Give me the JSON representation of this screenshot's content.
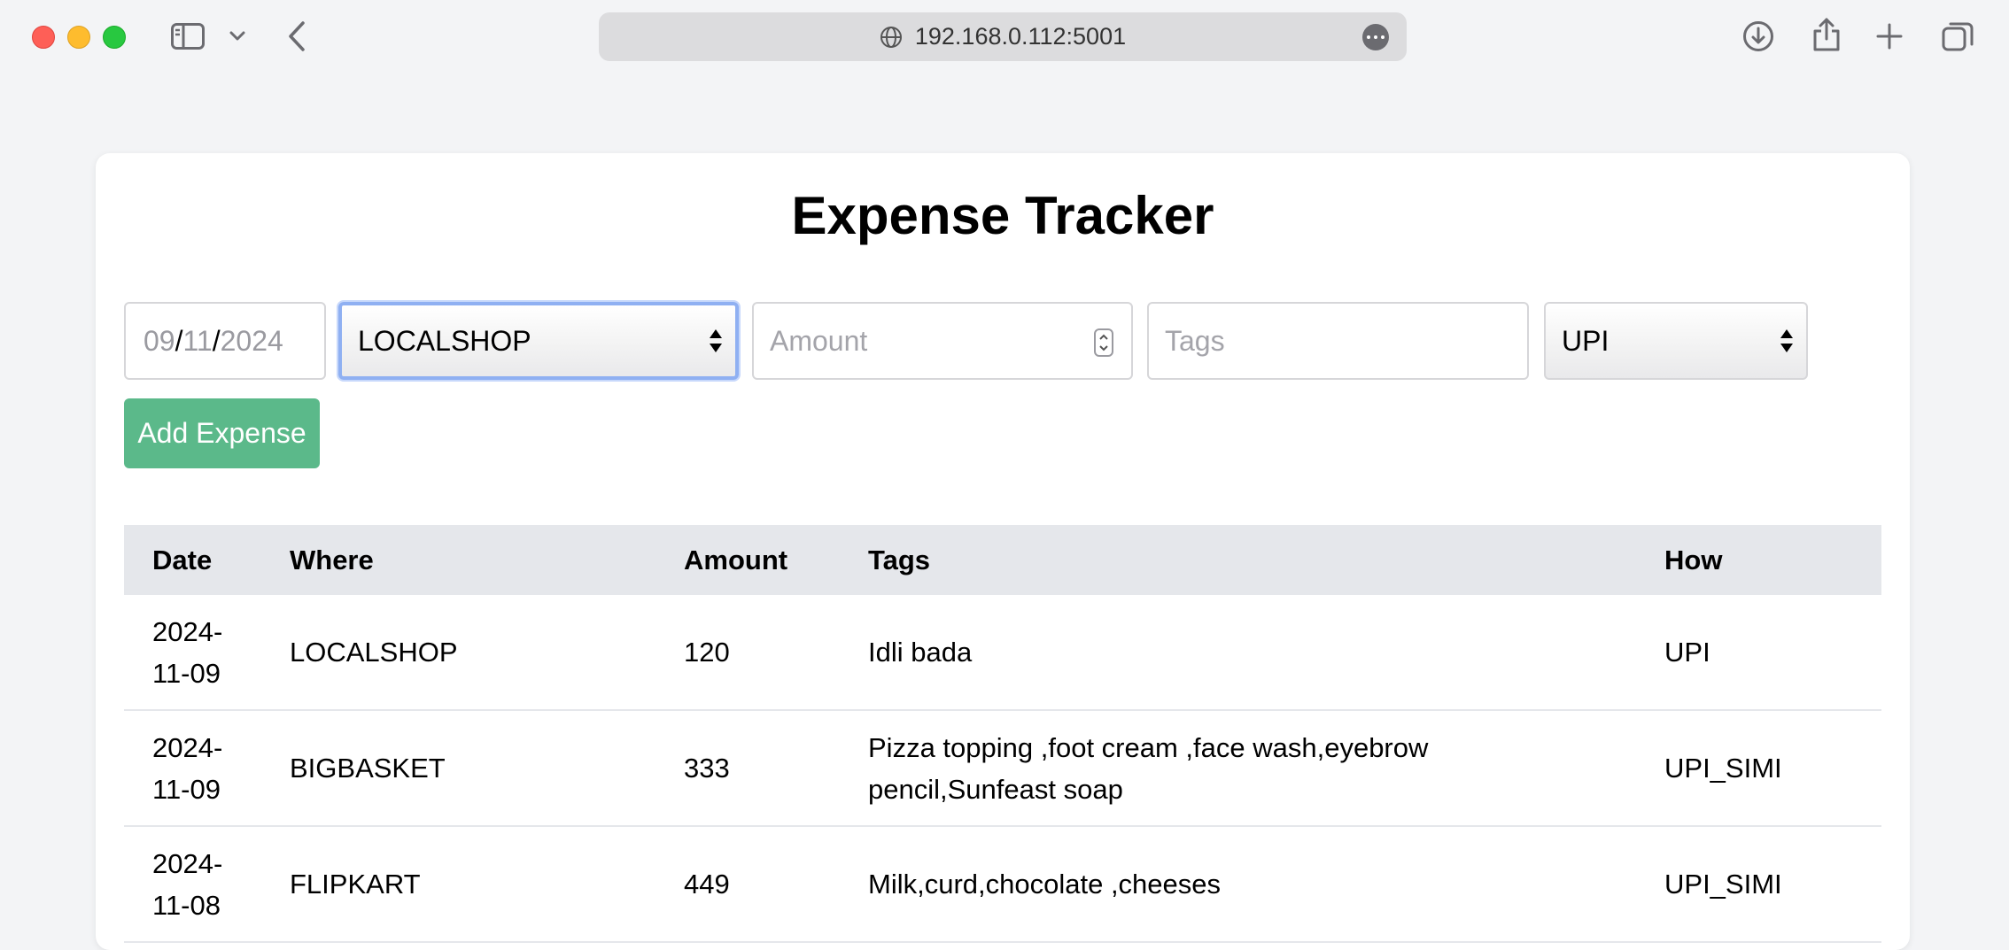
{
  "browser": {
    "url": "192.168.0.112:5001"
  },
  "page": {
    "title": "Expense Tracker"
  },
  "form": {
    "date": {
      "month": "09",
      "day": "11",
      "year": "2024",
      "separator": "/"
    },
    "where_selected": "LOCALSHOP",
    "amount_placeholder": "Amount",
    "tags_placeholder": "Tags",
    "how_selected": "UPI",
    "add_button_label": "Add Expense"
  },
  "table": {
    "headers": {
      "date": "Date",
      "where": "Where",
      "amount": "Amount",
      "tags": "Tags",
      "how": "How"
    },
    "rows": [
      {
        "date_a": "2024-",
        "date_b": "11-09",
        "where": "LOCALSHOP",
        "amount": "120",
        "tags": "Idli bada",
        "how": "UPI"
      },
      {
        "date_a": "2024-",
        "date_b": "11-09",
        "where": "BIGBASKET",
        "amount": "333",
        "tags": "Pizza topping ,foot cream ,face wash,eyebrow pencil,Sunfeast soap",
        "how": "UPI_SIMI"
      },
      {
        "date_a": "2024-",
        "date_b": "11-08",
        "where": "FLIPKART",
        "amount": "449",
        "tags": "Milk,curd,chocolate ,cheeses",
        "how": "UPI_SIMI"
      }
    ]
  },
  "colors": {
    "accent_button": "#5bb98a",
    "focus_ring": "#8fb0f2",
    "table_header_bg": "#e5e7eb"
  }
}
